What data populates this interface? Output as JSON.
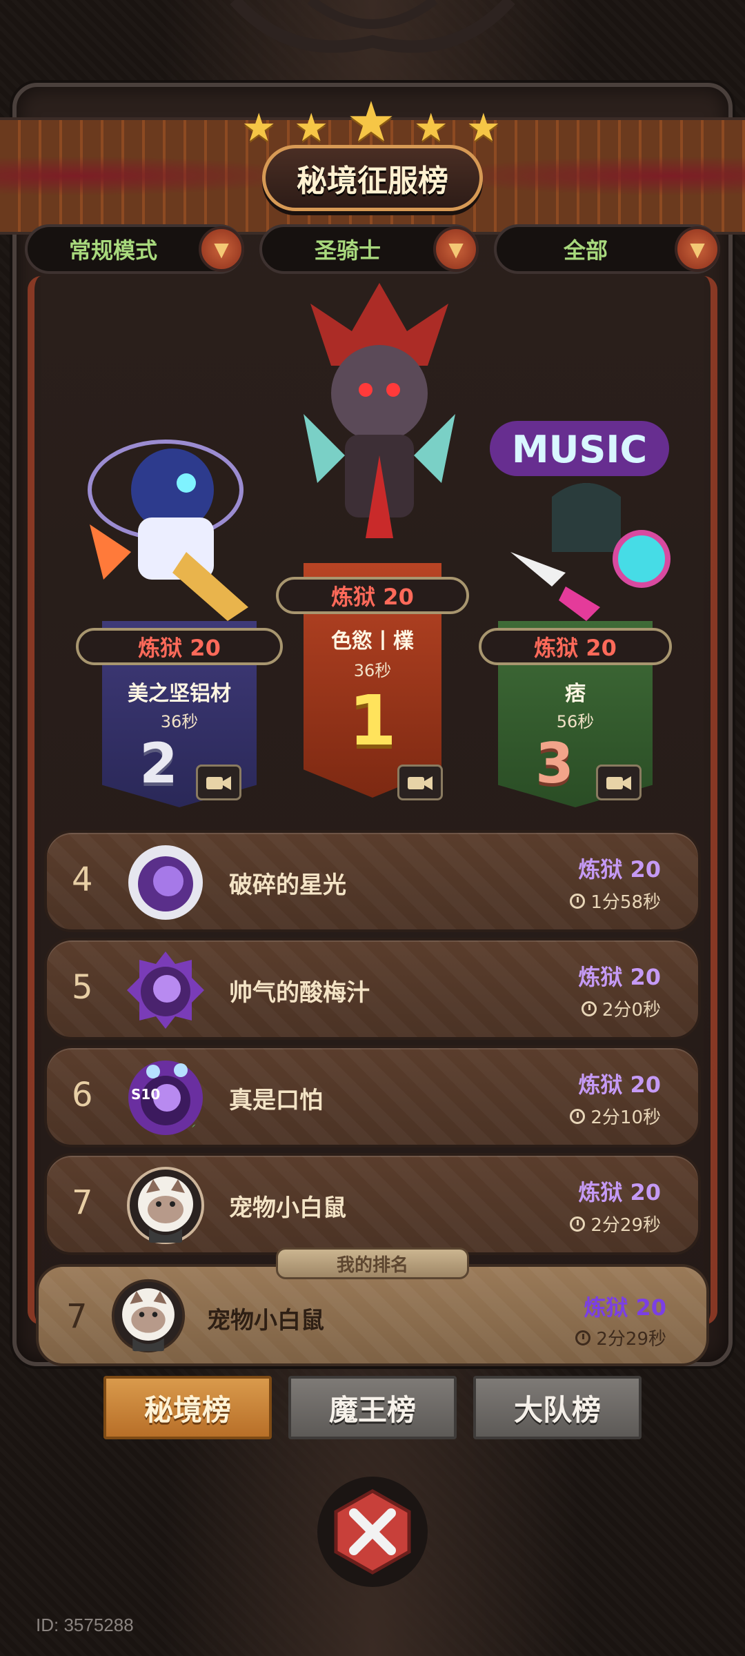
{
  "header": {
    "title": "秘境征服榜",
    "stars": [
      "★",
      "★",
      "★",
      "★",
      "★"
    ]
  },
  "filters": [
    {
      "label": "常规模式",
      "color": "#a8d97d"
    },
    {
      "label": "圣骑士",
      "color": "#a8d97d"
    },
    {
      "label": "全部",
      "color": "#a8d97d"
    }
  ],
  "podium": {
    "first": {
      "difficulty": "炼狱 20",
      "name": "色慾丨檏",
      "time": "36秒",
      "rank": "1"
    },
    "second": {
      "difficulty": "炼狱 20",
      "name": "美之坚铝材",
      "time": "36秒",
      "rank": "2"
    },
    "third": {
      "difficulty": "炼狱 20",
      "name": "痞",
      "time": "56秒",
      "rank": "3"
    },
    "third_hero_badge": "MUSIC"
  },
  "list": [
    {
      "rank": "4",
      "name": "破碎的星光",
      "difficulty": "炼狱 20",
      "time": "1分58秒",
      "avatar_icon": "astronaut-orb-icon"
    },
    {
      "rank": "5",
      "name": "帅气的酸梅汁",
      "difficulty": "炼狱 20",
      "time": "2分0秒",
      "avatar_icon": "purple-eye-orb-icon"
    },
    {
      "rank": "6",
      "name": "真是口怕",
      "difficulty": "炼狱 20",
      "time": "2分10秒",
      "avatar_icon": "tentacle-orb-icon",
      "badge": "S10"
    },
    {
      "rank": "7",
      "name": "宠物小白鼠",
      "difficulty": "炼狱 20",
      "time": "2分29秒",
      "avatar_icon": "rat-portrait-icon"
    }
  ],
  "my_rank": {
    "tag": "我的排名",
    "rank": "7",
    "name": "宠物小白鼠",
    "difficulty": "炼狱 20",
    "time": "2分29秒"
  },
  "tabs": [
    {
      "label": "秘境榜",
      "active": true
    },
    {
      "label": "魔王榜",
      "active": false
    },
    {
      "label": "大队榜",
      "active": false
    }
  ],
  "footer": {
    "id": "ID: 3575288"
  },
  "colors": {
    "difficulty_purple": "#c59af5",
    "difficulty_red": "#ff6a5a",
    "active_tab": "#d99a4c"
  }
}
